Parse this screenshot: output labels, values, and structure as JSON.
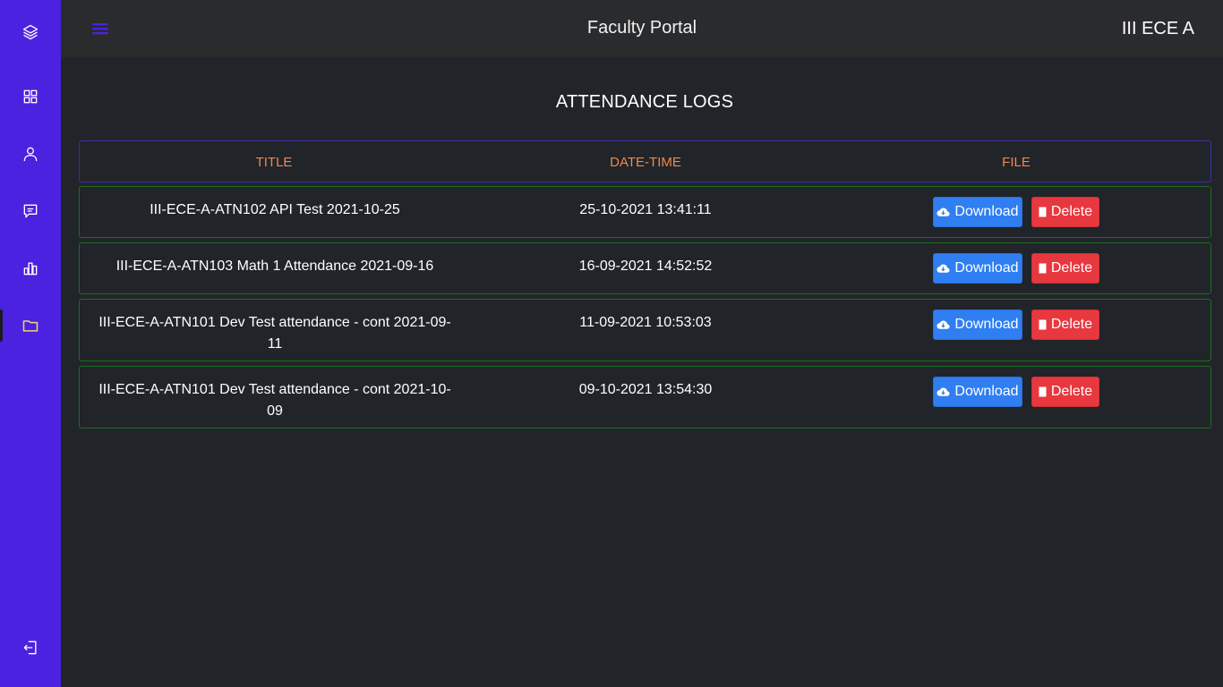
{
  "app": {
    "title": "Faculty Portal",
    "class_name": "III ECE A",
    "brand_color": "#4a22e0",
    "header_color": "#f0874e"
  },
  "sidebar": {
    "items": [
      {
        "icon": "layers-icon",
        "name": "home"
      },
      {
        "icon": "grid-icon",
        "name": "dashboard"
      },
      {
        "icon": "user-icon",
        "name": "profile"
      },
      {
        "icon": "message-icon",
        "name": "messages"
      },
      {
        "icon": "bar-chart-icon",
        "name": "analytics"
      },
      {
        "icon": "folder-icon",
        "name": "files",
        "active": true
      }
    ],
    "logout_icon": "logout-icon"
  },
  "page": {
    "heading": "ATTENDANCE LOGS"
  },
  "table": {
    "columns": [
      "TITLE",
      "DATE-TIME",
      "FILE"
    ],
    "rows": [
      {
        "title": "III-ECE-A-ATN102 API Test 2021-10-25",
        "datetime": "25-10-2021 13:41:11",
        "download": "Download",
        "delete": "Delete"
      },
      {
        "title": "III-ECE-A-ATN103 Math 1 Attendance 2021-09-16",
        "datetime": "16-09-2021 14:52:52",
        "download": "Download",
        "delete": "Delete"
      },
      {
        "title": "III-ECE-A-ATN101 Dev Test attendance - cont 2021-09-11",
        "datetime": "11-09-2021 10:53:03",
        "download": "Download",
        "delete": "Delete"
      },
      {
        "title": "III-ECE-A-ATN101 Dev Test attendance - cont 2021-10-09",
        "datetime": "09-10-2021 13:54:30",
        "download": "Download",
        "delete": "Delete"
      }
    ]
  }
}
